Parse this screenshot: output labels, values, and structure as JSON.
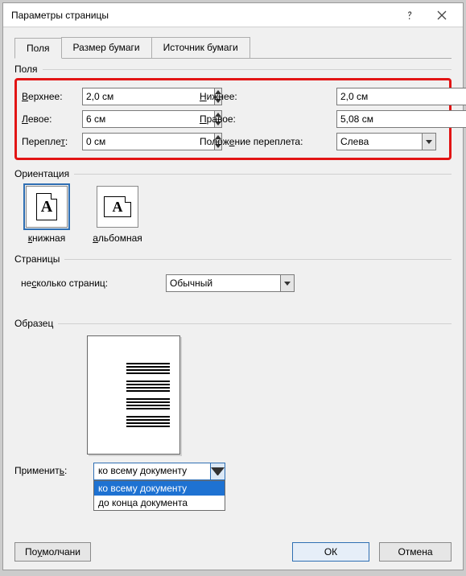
{
  "dialog": {
    "title": "Параметры страницы"
  },
  "tabs": {
    "t0": "Поля",
    "t1": "Размер бумаги",
    "t2": "Источник бумаги"
  },
  "margins": {
    "group": "Поля",
    "top_lbl_pre": "",
    "top_lbl_u": "В",
    "top_lbl_post": "ерхнее:",
    "top_val": "2,0 см",
    "bot_lbl_pre": "",
    "bot_lbl_u": "Н",
    "bot_lbl_post": "ижнее:",
    "bot_val": "2,0 см",
    "left_lbl_pre": "",
    "left_lbl_u": "Л",
    "left_lbl_post": "евое:",
    "left_val": "6 см",
    "right_lbl_pre": "",
    "right_lbl_u": "П",
    "right_lbl_post": "равое:",
    "right_val": "5,08 см",
    "gutter_lbl_pre": "Перепле",
    "gutter_lbl_u": "т",
    "gutter_lbl_post": ":",
    "gutter_val": "0 см",
    "gpos_lbl_pre": "Полож",
    "gpos_lbl_u": "е",
    "gpos_lbl_post": "ние переплета:",
    "gpos_val": "Слева"
  },
  "orientation": {
    "group": "Ориентация",
    "portrait_u": "к",
    "portrait_post": "нижная",
    "landscape_u": "а",
    "landscape_post": "льбомная"
  },
  "pages": {
    "group": "Страницы",
    "multi_pre": "не",
    "multi_u": "с",
    "multi_post": "колько страниц:",
    "multi_val": "Обычный"
  },
  "preview": {
    "group": "Образец"
  },
  "apply": {
    "lbl_pre": "Применит",
    "lbl_u": "ь",
    "lbl_post": ":",
    "value": "ко всему документу",
    "opt0": "ко всему документу",
    "opt1": "до конца документа"
  },
  "buttons": {
    "defaults_pre": "По ",
    "defaults_u": "у",
    "defaults_post": "молчани",
    "ok": "ОК",
    "cancel": "Отмена"
  }
}
